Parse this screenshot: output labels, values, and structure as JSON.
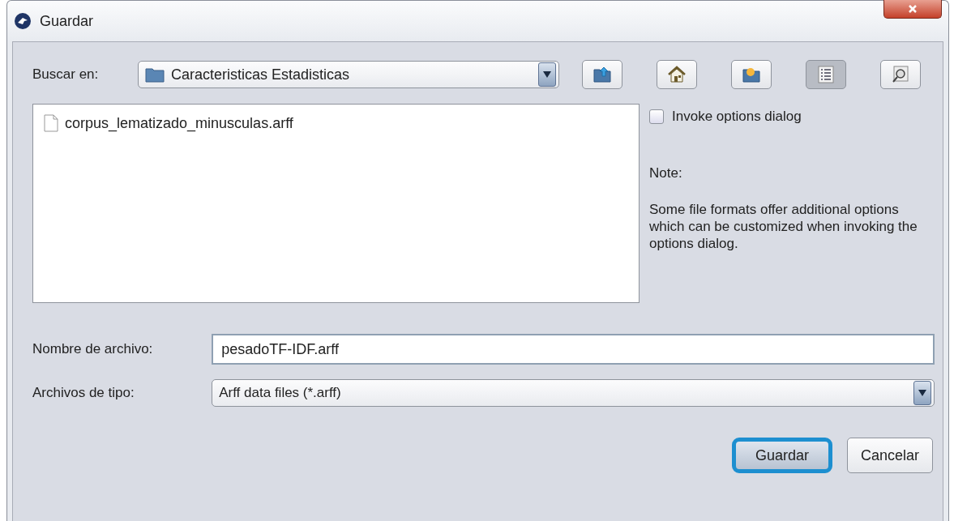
{
  "window": {
    "title": "Guardar"
  },
  "look_in": {
    "label": "Buscar en:",
    "value": "Caracteristicas Estadisticas"
  },
  "toolbar": [
    {
      "kind": "up",
      "selected": false
    },
    {
      "kind": "home",
      "selected": false
    },
    {
      "kind": "new-folder",
      "selected": false
    },
    {
      "kind": "list",
      "selected": true
    },
    {
      "kind": "details",
      "selected": false
    }
  ],
  "files": [
    {
      "name": "corpus_lematizado_minusculas.arff",
      "selected": false
    }
  ],
  "options": {
    "checkbox": {
      "label": "Invoke options dialog",
      "checked": false
    },
    "note_title": "Note:",
    "note": "Some file formats offer additional options which can be customized when invoking the options dialog."
  },
  "file_name": {
    "label": "Nombre de archivo:",
    "value": "pesadoTF-IDF.arff"
  },
  "file_type": {
    "label": "Archivos de tipo:",
    "value": "Arff data files (*.arff)"
  },
  "buttons": [
    {
      "label": "Guardar",
      "highlighted": true
    },
    {
      "label": "Cancelar",
      "highlighted": false
    }
  ]
}
